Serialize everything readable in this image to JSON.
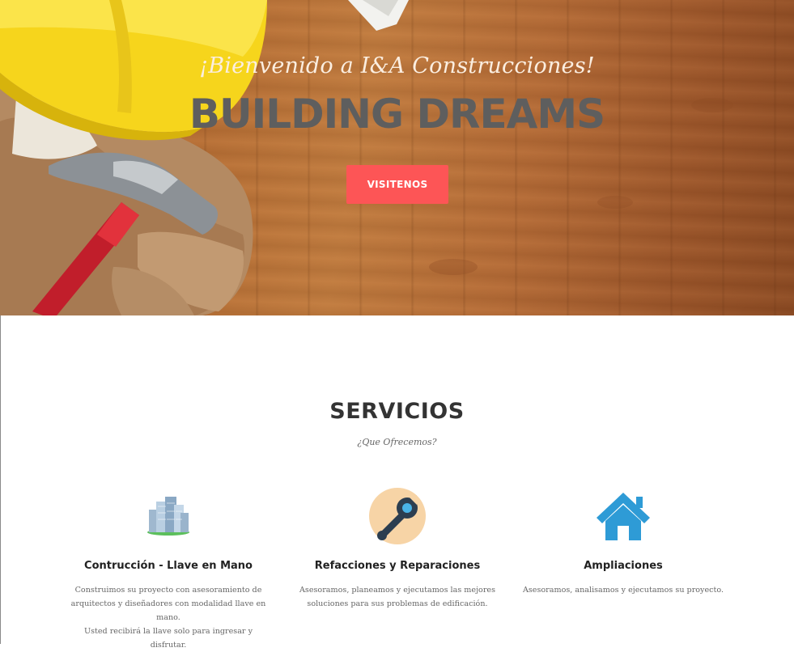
{
  "hero": {
    "welcome": "¡Bienvenido a I&A Construcciones!",
    "title": "BUILDING DREAMS",
    "button_label": "VISITENOS",
    "button_color": "#fd5556"
  },
  "services": {
    "title": "SERVICIOS",
    "subtitle": "¿Que Ofrecemos?",
    "items": [
      {
        "icon": "buildings-icon",
        "title": "Contrucción - Llave en Mano",
        "desc_lines": [
          "Construimos su proyecto con asesoramiento de",
          "arquitectos y diseñadores con modalidad llave en mano.",
          "Usted recibirá la llave solo para ingresar y disfrutar."
        ]
      },
      {
        "icon": "wrench-icon",
        "title": "Refacciones y Reparaciones",
        "desc_lines": [
          "Asesoramos, planeamos y ejecutamos las mejores",
          "soluciones para sus problemas de edificación."
        ]
      },
      {
        "icon": "house-icon",
        "title": "Ampliaciones",
        "desc_lines": [
          "Asesoramos, analisamos y ejecutamos su proyecto."
        ]
      }
    ]
  }
}
